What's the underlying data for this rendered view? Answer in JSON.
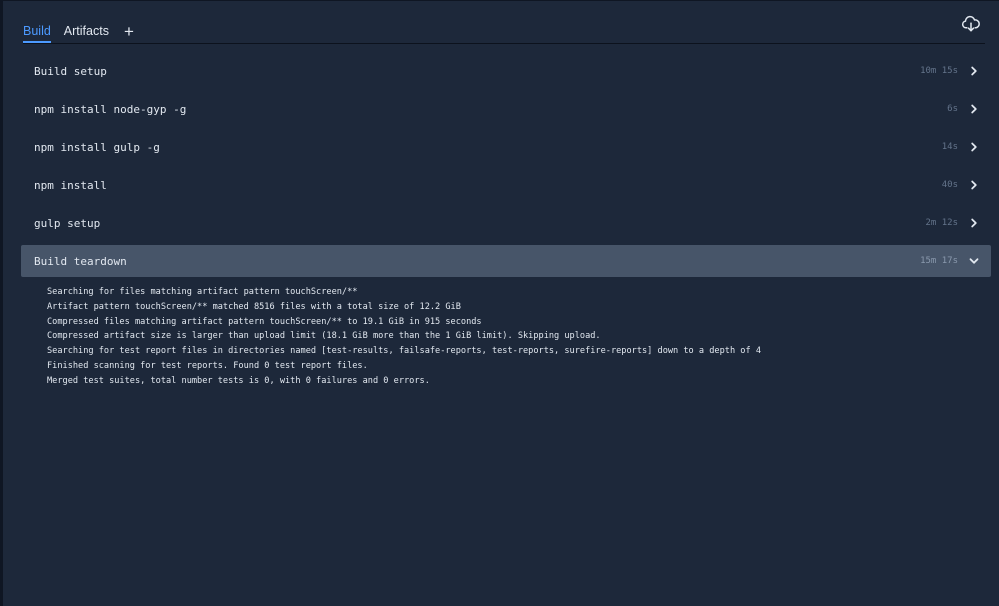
{
  "tabs": [
    {
      "label": "Build",
      "active": true
    },
    {
      "label": "Artifacts",
      "active": false
    }
  ],
  "tab_add_label": "+",
  "icons": {
    "cloud": "cloud-download-icon",
    "chevron_right": "chevron-right-icon",
    "chevron_down": "chevron-down-icon"
  },
  "colors": {
    "background": "#1d283a",
    "accent": "#4c9aff",
    "open_row": "#475569"
  },
  "steps": [
    {
      "title": "Build setup",
      "duration": "10m 15s",
      "expanded": false
    },
    {
      "title": "npm install node-gyp -g",
      "duration": "6s",
      "expanded": false
    },
    {
      "title": "npm install gulp -g",
      "duration": "14s",
      "expanded": false
    },
    {
      "title": "npm install",
      "duration": "40s",
      "expanded": false
    },
    {
      "title": "gulp setup",
      "duration": "2m 12s",
      "expanded": false
    },
    {
      "title": "Build teardown",
      "duration": "15m 17s",
      "expanded": true
    }
  ],
  "log_lines": [
    "Searching for files matching artifact pattern touchScreen/**",
    "Artifact pattern touchScreen/** matched 8516 files with a total size of 12.2 GiB",
    "Compressed files matching artifact pattern touchScreen/** to 19.1 GiB in 915 seconds",
    "Compressed artifact size is larger than upload limit (18.1 GiB more than the 1 GiB limit). Skipping upload.",
    "Searching for test report files in directories named [test-results, failsafe-reports, test-reports, surefire-reports] down to a depth of 4",
    "Finished scanning for test reports. Found 0 test report files.",
    "Merged test suites, total number tests is 0, with 0 failures and 0 errors."
  ]
}
